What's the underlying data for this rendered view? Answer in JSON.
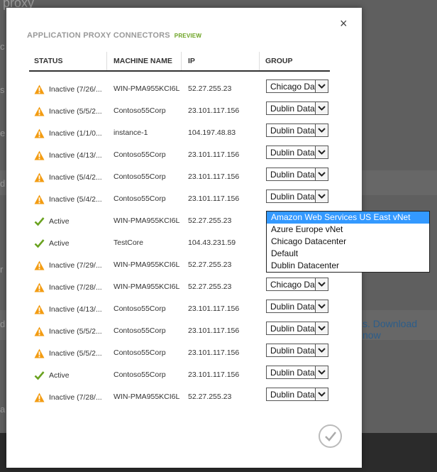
{
  "background": {
    "title_fragment": "proxy",
    "side_letters": [
      "c",
      "s",
      "e",
      "d",
      "r",
      "d",
      "a"
    ],
    "link_text": "s. Download now"
  },
  "modal": {
    "title": "APPLICATION PROXY CONNECTORS",
    "badge": "PREVIEW",
    "close_label": "×",
    "columns": {
      "status": "STATUS",
      "machine": "MACHINE NAME",
      "ip": "IP",
      "group": "GROUP"
    },
    "rows": [
      {
        "status": "Inactive (7/26/...",
        "state": "inactive",
        "machine": "WIN-PMA955KCI6L",
        "ip": "52.27.255.23",
        "group": "Chicago Datacenter"
      },
      {
        "status": "Inactive (5/5/2...",
        "state": "inactive",
        "machine": "Contoso55Corp",
        "ip": "23.101.117.156",
        "group": "Dublin Datacenter"
      },
      {
        "status": "Inactive (1/1/0...",
        "state": "inactive",
        "machine": "instance-1",
        "ip": "104.197.48.83",
        "group": "Dublin Datacenter"
      },
      {
        "status": "Inactive (4/13/...",
        "state": "inactive",
        "machine": "Contoso55Corp",
        "ip": "23.101.117.156",
        "group": "Dublin Datacenter"
      },
      {
        "status": "Inactive (5/4/2...",
        "state": "inactive",
        "machine": "Contoso55Corp",
        "ip": "23.101.117.156",
        "group": "Dublin Datacenter"
      },
      {
        "status": "Inactive (5/4/2...",
        "state": "inactive",
        "machine": "Contoso55Corp",
        "ip": "23.101.117.156",
        "group": "Dublin Datacenter"
      },
      {
        "status": "Active",
        "state": "active",
        "machine": "WIN-PMA955KCI6L",
        "ip": "52.27.255.23",
        "group": ""
      },
      {
        "status": "Active",
        "state": "active",
        "machine": "TestCore",
        "ip": "104.43.231.59",
        "group": ""
      },
      {
        "status": "Inactive (7/29/...",
        "state": "inactive",
        "machine": "WIN-PMA955KCI6L",
        "ip": "52.27.255.23",
        "group": ""
      },
      {
        "status": "Inactive (7/28/...",
        "state": "inactive",
        "machine": "WIN-PMA955KCI6L",
        "ip": "52.27.255.23",
        "group": "Chicago Datacenter"
      },
      {
        "status": "Inactive (4/13/...",
        "state": "inactive",
        "machine": "Contoso55Corp",
        "ip": "23.101.117.156",
        "group": "Dublin Datacenter"
      },
      {
        "status": "Inactive (5/5/2...",
        "state": "inactive",
        "machine": "Contoso55Corp",
        "ip": "23.101.117.156",
        "group": "Dublin Datacenter"
      },
      {
        "status": "Inactive (5/5/2...",
        "state": "inactive",
        "machine": "Contoso55Corp",
        "ip": "23.101.117.156",
        "group": "Dublin Datacenter"
      },
      {
        "status": "Active",
        "state": "active",
        "machine": "Contoso55Corp",
        "ip": "23.101.117.156",
        "group": "Dublin Datacenter"
      },
      {
        "status": "Inactive (7/28/...",
        "state": "inactive",
        "machine": "WIN-PMA955KCI6L",
        "ip": "52.27.255.23",
        "group": "Dublin Datacenter"
      }
    ],
    "dropdown": {
      "options": [
        {
          "label": "Amazon Web Services US East vNet",
          "selected": true
        },
        {
          "label": "Azure Europe vNet",
          "selected": false
        },
        {
          "label": "Chicago Datacenter",
          "selected": false
        },
        {
          "label": "Default",
          "selected": false
        },
        {
          "label": "Dublin Datacenter",
          "selected": false
        }
      ]
    },
    "ok_icon": "checkmark-icon"
  },
  "colors": {
    "warning": "#f39c12",
    "active": "#6aa220",
    "preview": "#6aa220",
    "dropdown_highlight": "#3399ff"
  }
}
